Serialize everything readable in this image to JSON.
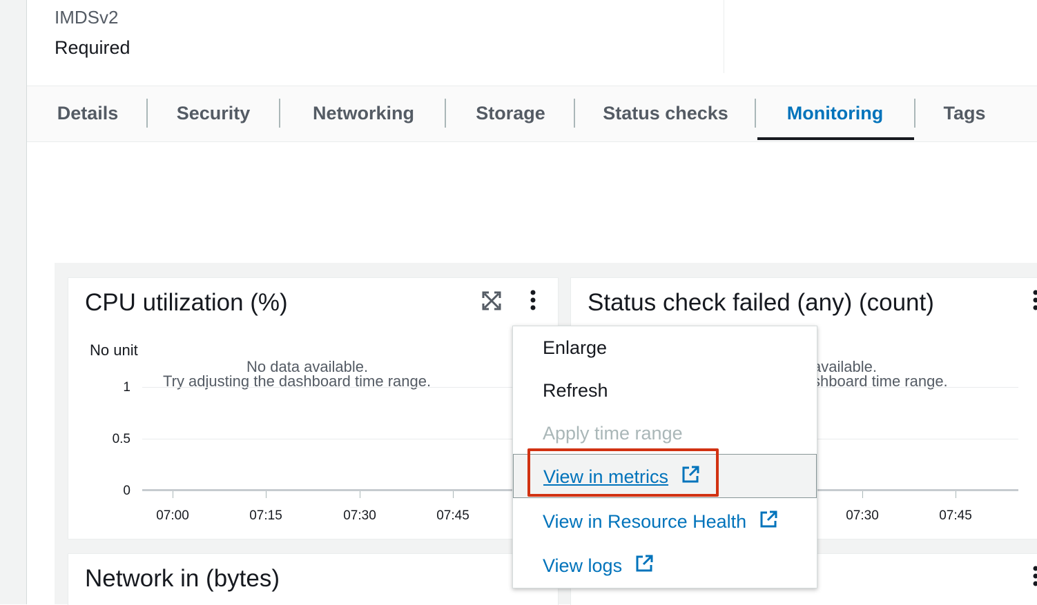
{
  "details": {
    "label": "IMDSv2",
    "value": "Required"
  },
  "tabs": [
    {
      "label": "Details"
    },
    {
      "label": "Security"
    },
    {
      "label": "Networking"
    },
    {
      "label": "Storage"
    },
    {
      "label": "Status checks"
    },
    {
      "label": "Monitoring",
      "active": true
    },
    {
      "label": "Tags"
    }
  ],
  "widgets": {
    "cpu": {
      "title": "CPU utilization (%)",
      "unit_label": "No unit",
      "no_data_line1": "No data available.",
      "no_data_line2": "Try adjusting the dashboard time range.",
      "y_ticks": [
        "1",
        "0.5",
        "0"
      ],
      "x_ticks": [
        "07:00",
        "07:15",
        "07:30",
        "07:45"
      ]
    },
    "status_check": {
      "title": "Status check failed (any) (count)",
      "no_data_line1_partial": "available.",
      "no_data_line2_partial": "shboard time range.",
      "x_ticks": [
        "07:30",
        "07:45"
      ]
    },
    "network_in": {
      "title": "Network in (bytes)"
    }
  },
  "context_menu": {
    "items": [
      {
        "label": "Enlarge",
        "state": "normal"
      },
      {
        "label": "Refresh",
        "state": "normal"
      },
      {
        "label": "Apply time range",
        "state": "disabled"
      },
      {
        "label": "View in metrics",
        "state": "link",
        "external": true,
        "hovered": true
      },
      {
        "label": "View in Resource Health",
        "state": "link",
        "external": true
      },
      {
        "label": "View logs",
        "state": "link",
        "external": true
      }
    ]
  },
  "colors": {
    "accent": "#0073bb",
    "highlight": "#d13212",
    "text": "#16191f",
    "muted": "#545b64"
  },
  "icons": [
    "fullscreen-icon",
    "more-vertical-icon",
    "external-link-icon"
  ]
}
